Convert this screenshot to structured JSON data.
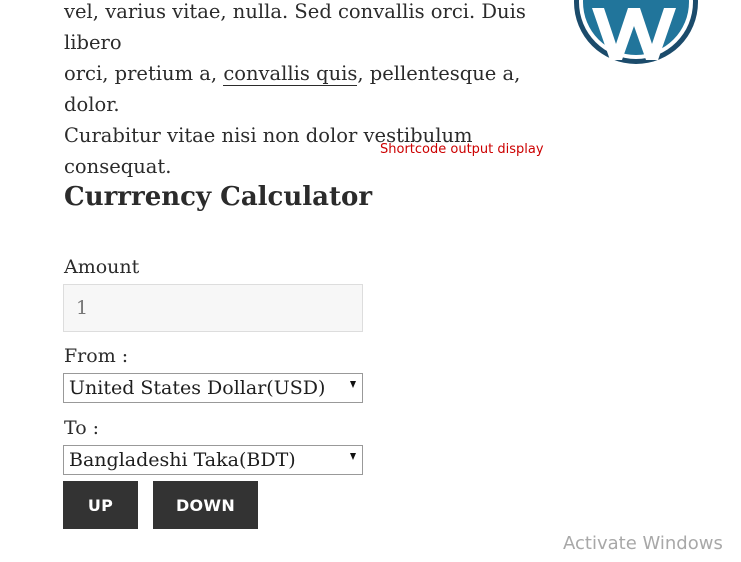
{
  "content": {
    "para_lines": [
      "vel, varius vitae, nulla. Sed convallis orci. Duis libero",
      "orci, pretium a, ",
      "convallis quis",
      ", pellentesque a, dolor.",
      "Curabitur vitae nisi non dolor vestibulum",
      "consequat."
    ]
  },
  "logo": {
    "icon": "wordpress-logo-icon",
    "color": "#21759b",
    "ring_color": "#1b4b6b"
  },
  "shortcode_note": "Shortcode output display",
  "calculator": {
    "title": "Currrency Calculator",
    "amount_label": "Amount",
    "amount_value": "1",
    "from_label": "From :",
    "from_value": "United States Dollar(USD)",
    "to_label": "To :",
    "to_value": "Bangladeshi Taka(BDT)",
    "up_label": "UP",
    "down_label": "DOWN"
  },
  "colors": {
    "note_red": "#cc0000",
    "button_bg": "#333333",
    "button_text": "#ffffff"
  },
  "watermark": "Activate Windows"
}
